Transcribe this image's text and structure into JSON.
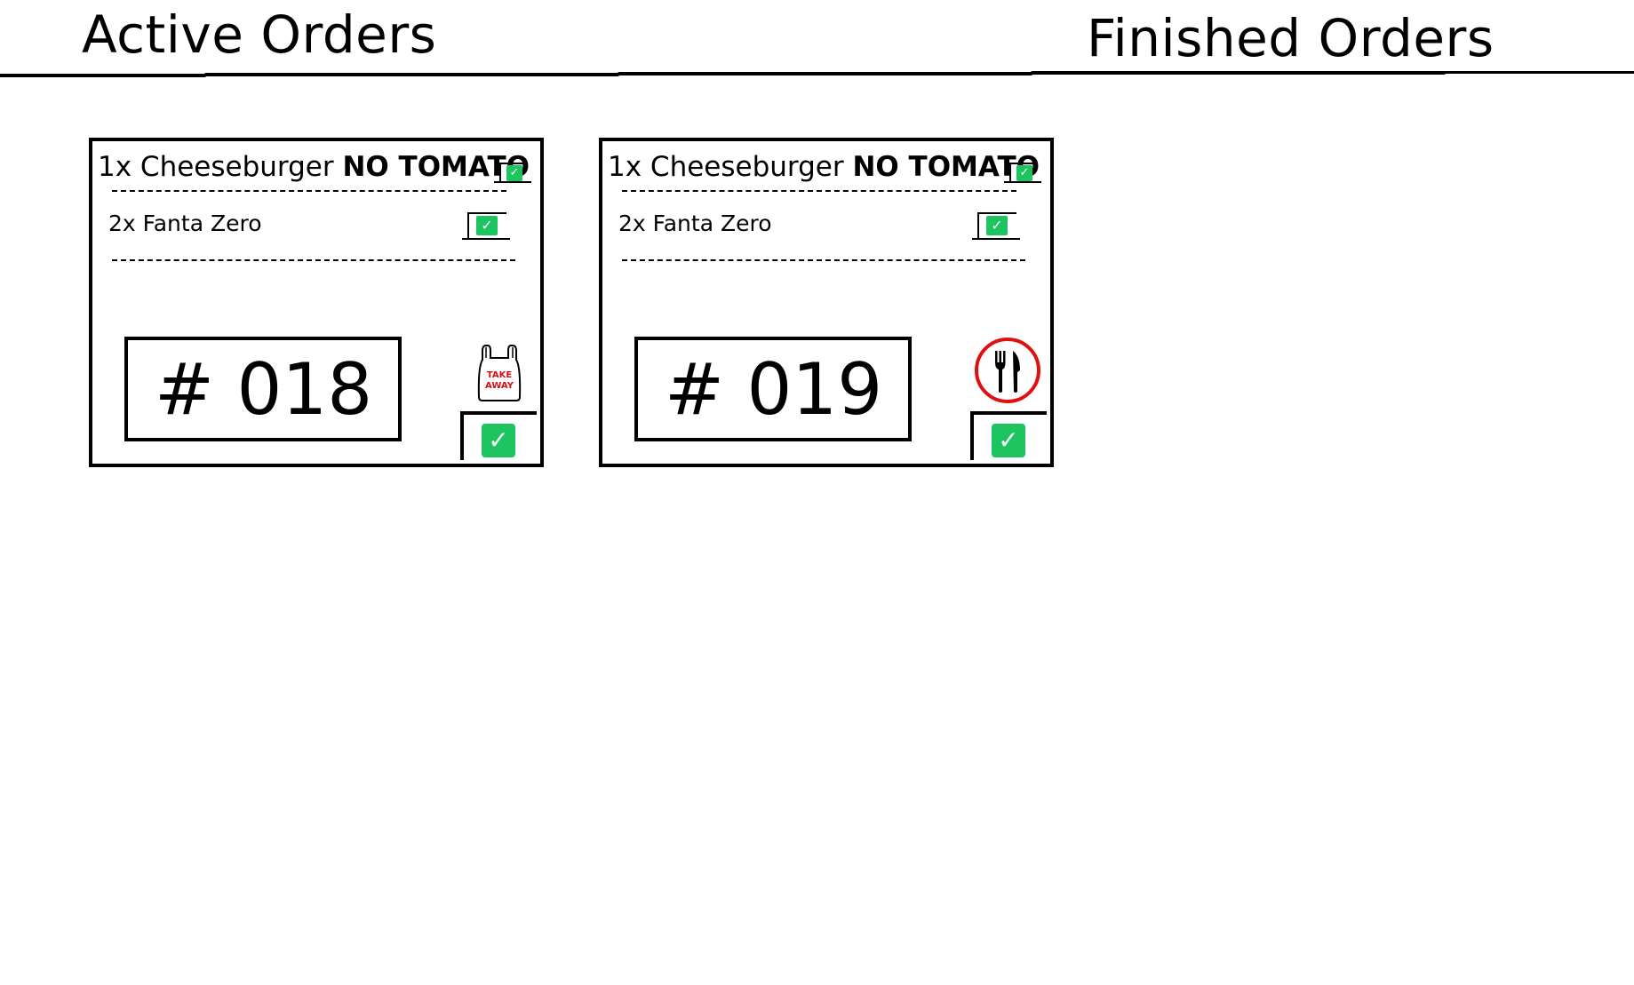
{
  "tabs": {
    "active": "Active Orders",
    "finished": "Finished Orders"
  },
  "colors": {
    "check_green": "#1dc45f",
    "dine_in_ring": "#e01010",
    "takeaway_text": "#d21010"
  },
  "orders": [
    {
      "number": "# 018",
      "type_icon": "takeaway-bag-icon",
      "type_label_line1": "TAKE",
      "type_label_line2": "AWAY",
      "items": [
        {
          "text": "1x Cheeseburger ",
          "note": "NO TOMATO",
          "checked": true
        },
        {
          "text": "2x Fanta Zero",
          "note": "",
          "checked": true
        }
      ],
      "done_checked": true
    },
    {
      "number": "# 019",
      "type_icon": "dine-in-cutlery-icon",
      "items": [
        {
          "text": "1x Cheeseburger ",
          "note": "NO TOMATO",
          "checked": true
        },
        {
          "text": "2x Fanta Zero",
          "note": "",
          "checked": true
        }
      ],
      "done_checked": true
    }
  ],
  "icons": {
    "item_check": "✓",
    "done_check": "✓"
  }
}
